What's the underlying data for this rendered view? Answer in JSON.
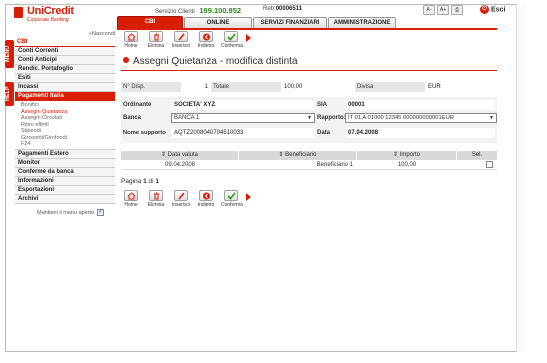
{
  "header": {
    "brand": "UniCredit",
    "brand_sub": "Corporate Banking",
    "service_label": "Servizio Clienti",
    "service_phone": "199.100.952",
    "reb_label": "Reb:",
    "reb_value": "00006511",
    "font_smaller": "A-",
    "font_larger": "A+",
    "esci": "Esci"
  },
  "tabs": [
    "CBI",
    "ONLINE",
    "SERVIZI FINANZIARI",
    "AMMINISTRAZIONE"
  ],
  "side_tabs": {
    "menu": "MENU",
    "help": "HELP"
  },
  "leftnav": {
    "nascondi": "«Nascondi",
    "section": "CBI",
    "items_top": [
      "Conti Correnti",
      "Conti Anticipi",
      "Rendic. Portafoglio",
      "Esiti",
      "Incassi"
    ],
    "active_item": "Pagamenti Italia",
    "subitems": [
      "Bonifici",
      "Assegni Quietanza",
      "Assegni Circolari",
      "Ritiro effetti",
      "Stipendi",
      "Giroconti/Girofondi",
      "F24"
    ],
    "items_bottom": [
      "Pagamenti Estero",
      "Monitor",
      "Conferme da banca",
      "Informazioni",
      "Esportazioni",
      "Archivi"
    ],
    "keep_open": "Mantieni il menu aperto"
  },
  "toolbar": {
    "home": "Home",
    "elimina": "Elimina",
    "inserisci": "Inserisci",
    "indietro": "Indietro",
    "conferma": "Conferma"
  },
  "page_title": "Assegni Quietanza - modifica distinta",
  "summary": {
    "n_disp_label": "N° Disp.",
    "n_disp_value": "1",
    "totale_label": "Totale",
    "totale_value": "100,00",
    "divisa_label": "Divisa",
    "divisa_value": "EUR"
  },
  "details": {
    "ordinante_label": "Ordinante",
    "ordinante_value": "SOCIETA' XYZ",
    "sia_label": "SIA",
    "sia_value": "00001",
    "banca_label": "Banca",
    "banca_value": "BANCA 1",
    "rapporto_label": "Rapporto:",
    "rapporto_value": "IT 01 A 01000 12345 000000000001EUR",
    "supporto_label": "Nome supporto",
    "supporto_value": "AQTZ2008040704510033",
    "data_label": "Data",
    "data_value": "07.04.2008"
  },
  "table": {
    "headers": [
      "Data valuta",
      "Beneficiario",
      "Importo",
      "Sel."
    ],
    "rows": [
      {
        "data_valuta": "09.04.2008",
        "beneficiario": "Beneficiario 1",
        "importo": "100,00"
      }
    ]
  },
  "pagination": {
    "label": "Pagina",
    "current": "1",
    "of": "di",
    "total": "1"
  },
  "colors": {
    "brand_red": "#d81e05",
    "phone_green": "#2e8b1e"
  }
}
